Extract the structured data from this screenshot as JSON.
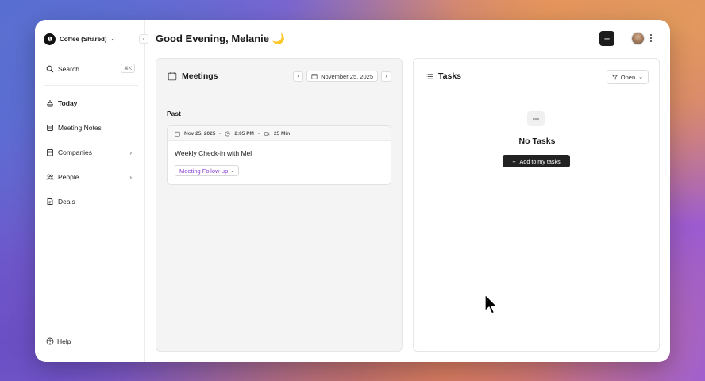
{
  "workspace": {
    "name": "Coffee (Shared)"
  },
  "sidebar": {
    "search_label": "Search",
    "search_shortcut": "⌘K",
    "items": [
      {
        "label": "Today",
        "icon": "sunrise-icon",
        "active": true
      },
      {
        "label": "Meeting Notes",
        "icon": "notes-icon"
      },
      {
        "label": "Companies",
        "icon": "building-icon",
        "has_submenu": true
      },
      {
        "label": "People",
        "icon": "people-icon",
        "has_submenu": true
      },
      {
        "label": "Deals",
        "icon": "deals-icon"
      }
    ],
    "help_label": "Help"
  },
  "header": {
    "greeting": "Good Evening, Melanie 🌙"
  },
  "meetings": {
    "title": "Meetings",
    "date": "November 25, 2025",
    "section_label": "Past",
    "cards": [
      {
        "date": "Nov 25, 2025",
        "time": "2:05 PM",
        "duration": "25 Min",
        "title": "Weekly Check-in with Mel",
        "tag": "Meeting Follow-up"
      }
    ]
  },
  "tasks": {
    "title": "Tasks",
    "filter_label": "Open",
    "empty_title": "No Tasks",
    "add_button_label": "Add to my tasks"
  },
  "colors": {
    "accent_purple": "#8a3fd1",
    "dark_button": "#1c1c1c"
  }
}
